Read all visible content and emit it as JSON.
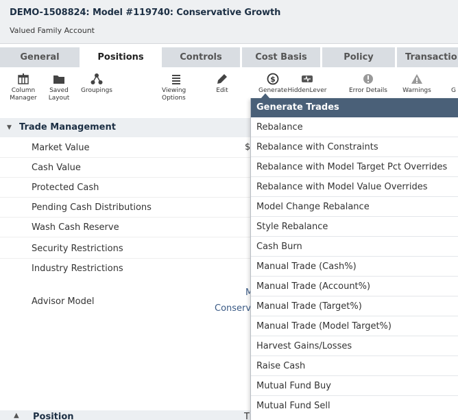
{
  "header": {
    "title": "DEMO-1508824: Model #119740: Conservative Growth",
    "subtitle": "Valued Family Account"
  },
  "tabs": [
    {
      "label": "General",
      "active": false
    },
    {
      "label": "Positions",
      "active": true
    },
    {
      "label": "Controls",
      "active": false
    },
    {
      "label": "Cost Basis",
      "active": false
    },
    {
      "label": "Policy",
      "active": false
    },
    {
      "label": "Transactio",
      "active": false
    }
  ],
  "toolbar": [
    {
      "label": "Column\nManager",
      "icon": "column-manager-icon"
    },
    {
      "label": "Saved\nLayout",
      "icon": "folder-icon"
    },
    {
      "label": "Groupings",
      "icon": "groupings-icon"
    },
    {
      "label": "Viewing\nOptions",
      "icon": "list-icon"
    },
    {
      "label": "Edit",
      "icon": "pencil-icon"
    },
    {
      "label": "Generate",
      "icon": "generate-dollar-icon"
    },
    {
      "label": "HiddenLever",
      "icon": "hidden-lever-icon"
    },
    {
      "label": "Error Details",
      "icon": "error-icon"
    },
    {
      "label": "Warnings",
      "icon": "warning-icon"
    },
    {
      "label": "G",
      "icon": ""
    }
  ],
  "trade_management": {
    "heading": "Trade Management",
    "rows": [
      "Market Value",
      "Cash Value",
      "Protected Cash",
      "Pending Cash Distributions",
      "Wash Cash Reserve",
      "Security Restrictions",
      "Industry Restrictions",
      "Advisor Model"
    ],
    "fragments": {
      "market_value": "$",
      "advisor_link_top": "M",
      "advisor_link": "Conserva"
    }
  },
  "position_section": {
    "heading": "Position",
    "fragment": "T"
  },
  "dropdown": {
    "heading": "Generate Trades",
    "items": [
      "Rebalance",
      "Rebalance with Constraints",
      "Rebalance with Model Target Pct Overrides",
      "Rebalance with Model Value Overrides",
      "Model Change Rebalance",
      "Style Rebalance",
      "Cash Burn",
      "Manual Trade (Cash%)",
      "Manual Trade (Account%)",
      "Manual Trade (Target%)",
      "Manual Trade (Model Target%)",
      "Harvest Gains/Losses",
      "Raise Cash",
      "Mutual Fund Buy",
      "Mutual Fund Sell"
    ]
  },
  "colors": {
    "dropdown_header": "#4a6078",
    "tab_inactive": "#d9dde2",
    "header_bg": "#eef0f2",
    "title_text": "#1c2f44"
  }
}
